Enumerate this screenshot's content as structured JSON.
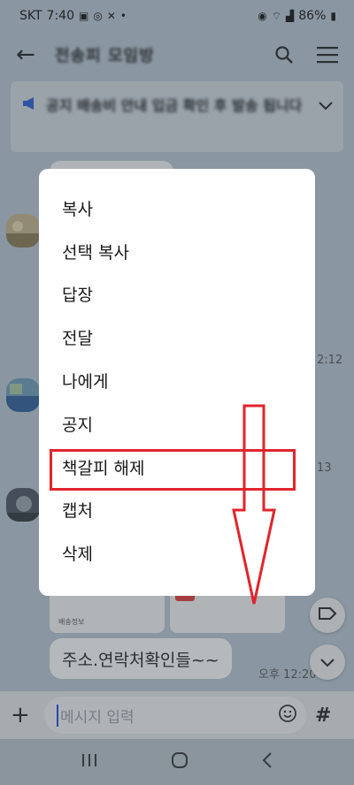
{
  "status_bar": {
    "carrier": "SKT",
    "time": "7:40",
    "battery": "86%",
    "icons": [
      "gallery-icon",
      "at-icon",
      "x-icon",
      "dot-icon",
      "hotspot-icon",
      "wifi-icon",
      "signal-icon",
      "battery-icon"
    ]
  },
  "header": {
    "title": "전송피 모임방",
    "icons": [
      "back-arrow-icon",
      "search-icon",
      "hamburger-menu-icon"
    ]
  },
  "notice": {
    "text": "공지 배송비 안내 입금 확인 후 발송 됩니다",
    "icon": "megaphone-icon",
    "accent": "#2b5bd7"
  },
  "chat": {
    "times": [
      "2:12",
      "13",
      "오후 12:20"
    ],
    "last_message": "주소.연락처확인들~~"
  },
  "context_menu": {
    "items": [
      "복사",
      "선택 복사",
      "답장",
      "전달",
      "나에게",
      "공지",
      "책갈피 해제",
      "캡처",
      "삭제"
    ],
    "highlighted_index": 6,
    "highlight_color": "#e0242c"
  },
  "composer": {
    "placeholder": "메시지 입력",
    "icons": [
      "plus-icon",
      "emoji-icon",
      "hash-icon"
    ]
  },
  "nav_bar": {
    "icons": [
      "recents-icon",
      "home-icon",
      "back-icon"
    ]
  }
}
